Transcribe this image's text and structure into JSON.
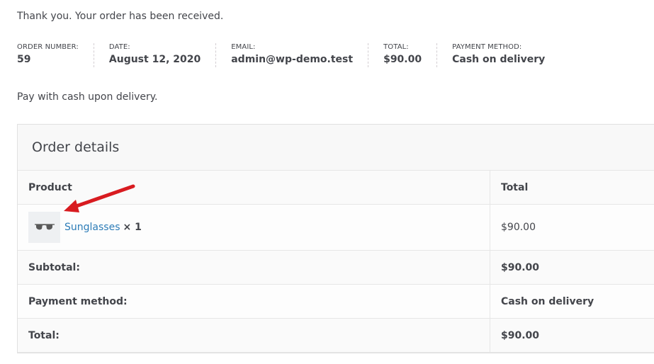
{
  "thank_you": "Thank you. Your order has been received.",
  "overview": [
    {
      "label": "ORDER NUMBER:",
      "value": "59"
    },
    {
      "label": "DATE:",
      "value": "August 12, 2020"
    },
    {
      "label": "EMAIL:",
      "value": "admin@wp-demo.test"
    },
    {
      "label": "TOTAL:",
      "value": "$90.00"
    },
    {
      "label": "PAYMENT METHOD:",
      "value": "Cash on delivery"
    }
  ],
  "payment_note": "Pay with cash upon delivery.",
  "order_details": {
    "title": "Order details",
    "headers": {
      "product": "Product",
      "total": "Total"
    },
    "item": {
      "name": "Sunglasses",
      "qty": "× 1",
      "total": "$90.00",
      "thumbnail_icon": "sunglasses-icon"
    },
    "footer": [
      {
        "label": "Subtotal:",
        "value": "$90.00"
      },
      {
        "label": "Payment method:",
        "value": "Cash on delivery"
      },
      {
        "label": "Total:",
        "value": "$90.00"
      }
    ]
  },
  "colors": {
    "link": "#2c7cb7",
    "annotation_arrow": "#d81b20",
    "text": "#43454b"
  }
}
